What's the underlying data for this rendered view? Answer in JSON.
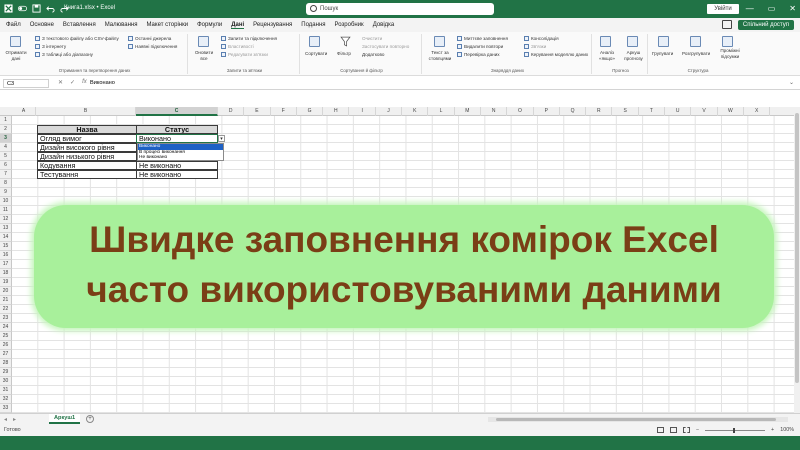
{
  "titlebar": {
    "doc_title": "Книга1.xlsx  •  Excel",
    "search_placeholder": "Пошук",
    "signin_label": "Увійти",
    "window_buttons": [
      "—",
      "▭",
      "✕"
    ]
  },
  "menu": {
    "tabs": [
      "Файл",
      "Основне",
      "Вставлення",
      "Малювання",
      "Макет сторінки",
      "Формули",
      "Дані",
      "Рецензування",
      "Подання",
      "Розробник",
      "Довідка"
    ],
    "active_tab": "Дані",
    "share_label": "Спільний доступ"
  },
  "ribbon": {
    "get_data": {
      "big_label": "Отримати дані",
      "items": [
        "З текстового файлу або CSV-файлу",
        "З інтернету",
        "З таблиці або діапазону",
        "Останні джерела",
        "Наявні підключення"
      ],
      "group_label": "Отримання та перетворення даних"
    },
    "queries": {
      "big_label": "Оновити все",
      "items": [
        "Запити та підключення",
        "Властивості",
        "Редагувати зв'язки"
      ],
      "group_label": "Запити та зв'язки"
    },
    "sort_filter": {
      "items": [
        "Сортувати",
        "Фільтр",
        "Очистити",
        "Застосувати повторно",
        "Додатково"
      ],
      "group_label": "Сортування й фільтр"
    },
    "data_tools": {
      "big_label": "Текст за стовпцями",
      "items": [
        "Миттєве заповнення",
        "Видалити повтори",
        "Перевірка даних",
        "Консолідація",
        "Зв'язки",
        "Керування моделлю даних"
      ],
      "group_label": "Знаряддя даних"
    },
    "forecast": {
      "items": [
        "Аналіз «якщо»",
        "Аркуш прогнозу"
      ],
      "group_label": "Прогноз"
    },
    "outline": {
      "items": [
        "Групувати",
        "Розгрупувати",
        "Проміжні підсумки"
      ],
      "group_label": "Структура"
    }
  },
  "formula_bar": {
    "name_box": "C3",
    "icons": [
      "✕",
      "✓",
      "fx"
    ],
    "value": "Виконано"
  },
  "grid": {
    "columns": [
      "A",
      "B",
      "C",
      "D",
      "E",
      "F",
      "G",
      "H",
      "I",
      "J",
      "K",
      "L",
      "M",
      "N",
      "O",
      "P",
      "Q",
      "R",
      "S",
      "T",
      "U",
      "V",
      "W",
      "X"
    ],
    "rows": [
      "1",
      "2",
      "3",
      "4",
      "5",
      "6",
      "7",
      "8",
      "9",
      "10",
      "11",
      "12",
      "13",
      "14",
      "15",
      "16",
      "17",
      "18",
      "19",
      "20",
      "21",
      "22",
      "23",
      "24",
      "25",
      "26",
      "27",
      "28",
      "29",
      "30",
      "31",
      "32",
      "33"
    ],
    "selected_column": "C",
    "selected_row": "3"
  },
  "table": {
    "header": [
      "Назва",
      "Статус"
    ],
    "rows": [
      [
        "Огляд вимог",
        "Виконано"
      ],
      [
        "Дизайн високого рівня",
        ""
      ],
      [
        "Дизайн низького рівня",
        ""
      ],
      [
        "Кодування",
        "Не виконано"
      ],
      [
        "Тестування",
        "Не виконано"
      ]
    ],
    "dropdown_options": [
      "Виконано",
      "В процесі виконання",
      "Не виконано"
    ],
    "dropdown_highlighted": "Виконано"
  },
  "banner": {
    "line1": "Швидке заповнення комірок Excel",
    "line2": "часто використовуваними даними"
  },
  "sheet_bar": {
    "sheet_name": "Аркуш1"
  },
  "statusbar": {
    "left": "Готово",
    "zoom": "100%"
  }
}
